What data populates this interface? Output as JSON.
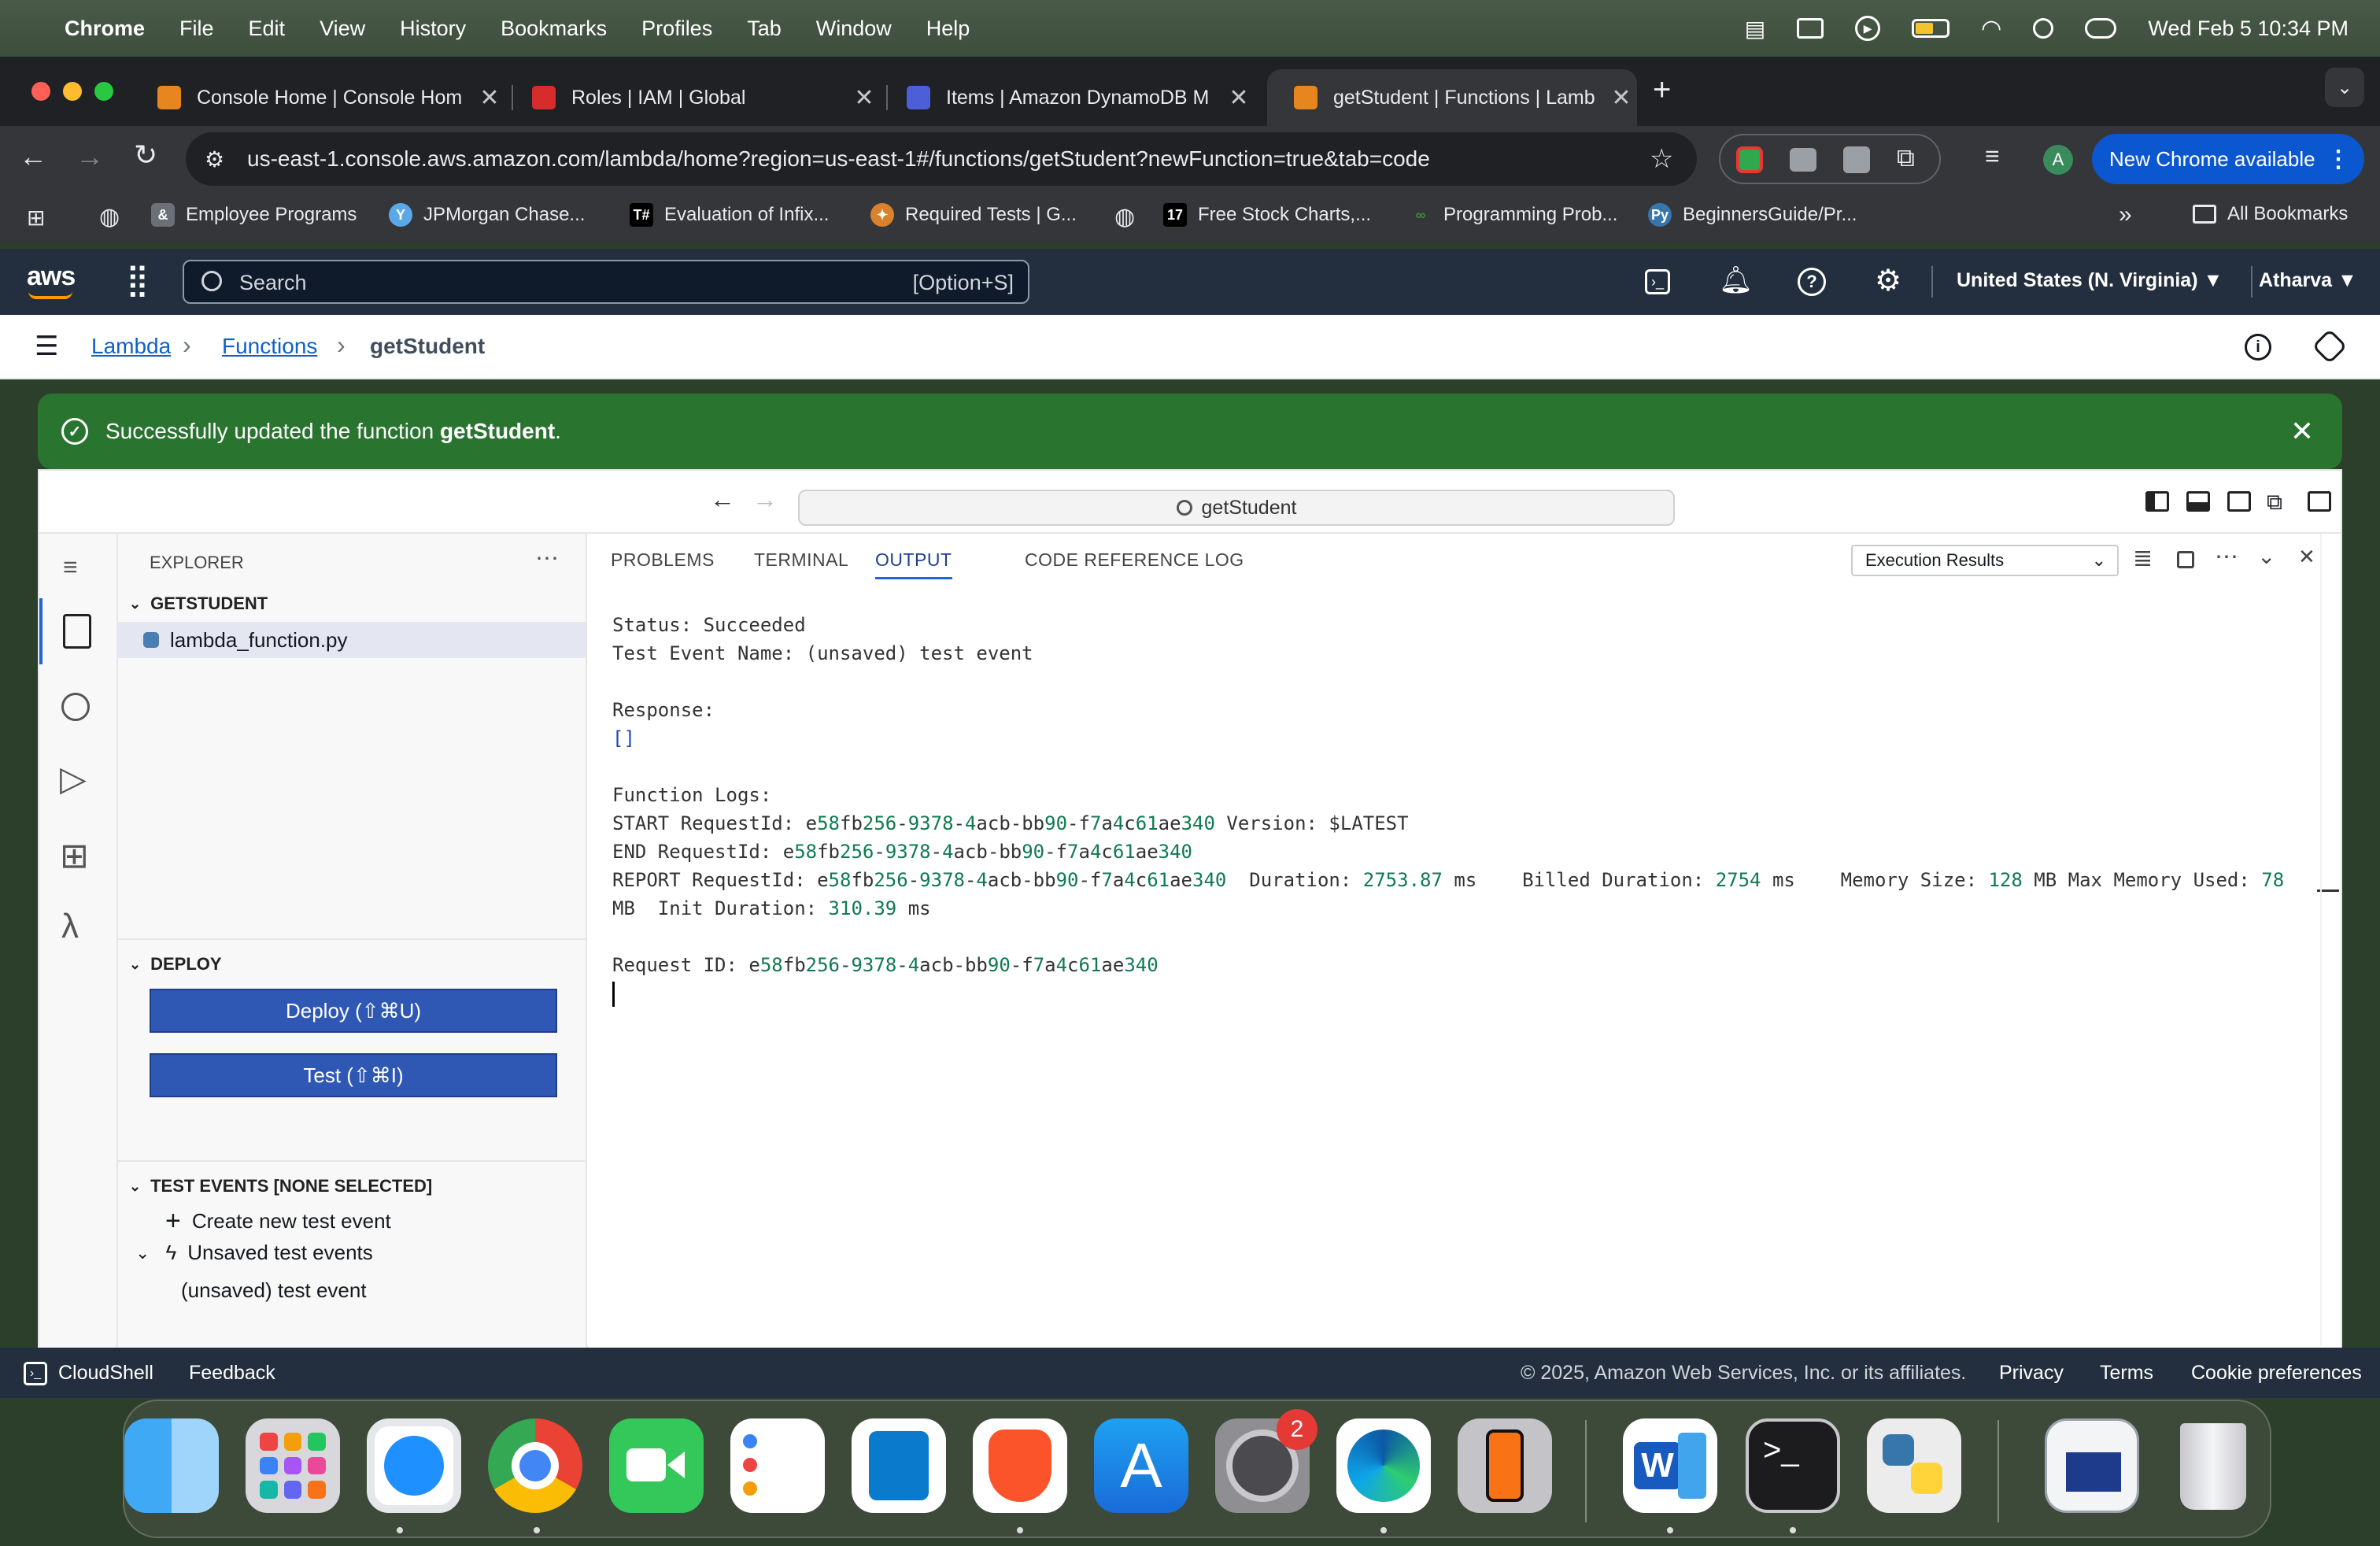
{
  "menubar": {
    "app": "Chrome",
    "items": [
      "File",
      "Edit",
      "View",
      "History",
      "Bookmarks",
      "Profiles",
      "Tab",
      "Window",
      "Help"
    ],
    "datetime": "Wed Feb 5  10:34 PM"
  },
  "tabs": [
    {
      "title": "Console Home | Console Hom",
      "active": false
    },
    {
      "title": "Roles | IAM | Global",
      "active": false
    },
    {
      "title": "Items | Amazon DynamoDB M",
      "active": false
    },
    {
      "title": "getStudent | Functions | Lamb",
      "active": true
    }
  ],
  "address_bar": {
    "url": "us-east-1.console.aws.amazon.com/lambda/home?region=us-east-1#/functions/getStudent?newFunction=true&tab=code"
  },
  "profile_initial": "A",
  "new_chrome_label": "New Chrome available",
  "bookmarks": [
    "Employee Programs",
    "JPMorgan Chase...",
    "Evaluation of Infix...",
    "Required Tests | G...",
    "Free Stock Charts,...",
    "Programming Prob...",
    "BeginnersGuide/Pr..."
  ],
  "all_bookmarks_label": "All Bookmarks",
  "aws": {
    "logo": "aws",
    "search_placeholder": "Search",
    "search_shortcut": "[Option+S]",
    "region": "United States (N. Virginia)",
    "user": "Atharva"
  },
  "breadcrumb": {
    "lambda": "Lambda",
    "functions": "Functions",
    "current": "getStudent"
  },
  "banner": {
    "prefix": "Successfully updated the function ",
    "function": "getStudent",
    "suffix": "."
  },
  "ide": {
    "command_center": "getStudent",
    "explorer_title": "EXPLORER",
    "project_name": "GETSTUDENT",
    "file_name": "lambda_function.py",
    "deploy_section": "DEPLOY",
    "deploy_button": "Deploy (⇧⌘U)",
    "test_button": "Test (⇧⌘I)",
    "test_events_section": "TEST EVENTS [NONE SELECTED]",
    "create_test_event": "Create new test event",
    "unsaved_test_events": "Unsaved test events",
    "unsaved_event": "(unsaved) test event",
    "panel_tabs": [
      "PROBLEMS",
      "TERMINAL",
      "OUTPUT",
      "CODE REFERENCE LOG"
    ],
    "active_panel_tab": "OUTPUT",
    "output_channel": "Execution Results"
  },
  "output": {
    "status": "Status: Succeeded",
    "event_name": "Test Event Name: (unsaved) test event",
    "response_label": "Response:",
    "response_value": "[]",
    "logs_label": "Function Logs:",
    "start_line": "START RequestId: e58fb256-9378-4acb-bb90-f7a4c61ae340 Version: $LATEST",
    "end_line": "END RequestId: e58fb256-9378-4acb-bb90-f7a4c61ae340",
    "report_line_1": "REPORT RequestId: e58fb256-9378-4acb-bb90-f7a4c61ae340  Duration: 2753.87 ms    Billed Duration: 2754 ms    Memory Size: 128 MB Max Memory Used: 78",
    "report_line_2": "MB  Init Duration: 310.39 ms",
    "request_id_line": "Request ID: e58fb256-9378-4acb-bb90-f7a4c61ae340"
  },
  "footer": {
    "cloudshell": "CloudShell",
    "feedback": "Feedback",
    "copyright": "© 2025, Amazon Web Services, Inc. or its affiliates.",
    "privacy": "Privacy",
    "terms": "Terms",
    "cookie": "Cookie preferences"
  },
  "dock": {
    "apps": [
      "finder-icon",
      "launchpad-icon",
      "safari-icon",
      "chrome-icon",
      "facetime-icon",
      "reminders-icon",
      "vscode-icon",
      "brave-icon",
      "app-store-icon",
      "system-settings-icon",
      "edge-icon",
      "iphone-mirroring-icon",
      "word-icon",
      "terminal-icon",
      "python-launcher-icon",
      "preview-icon",
      "trash-icon"
    ],
    "settings_badge": "2"
  },
  "colors": {
    "aws_nav": "#232f3e",
    "success_green": "#29742f",
    "primary_button": "#2e58b4",
    "log_number": "#0f7a50"
  }
}
